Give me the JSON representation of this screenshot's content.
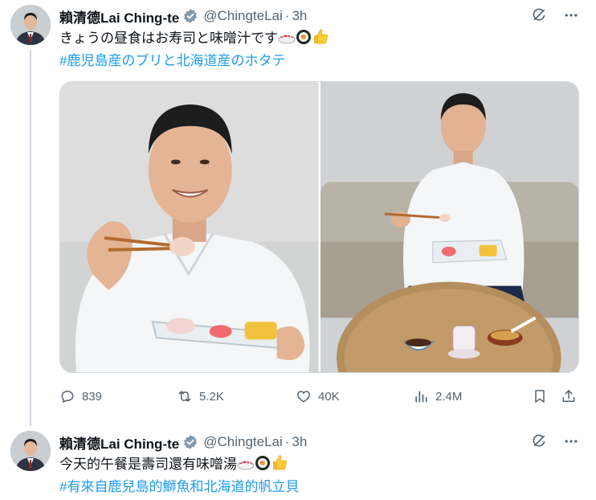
{
  "tweets": [
    {
      "author_name": "賴清德Lai Ching-te",
      "handle": "@ChingteLai",
      "separator": "·",
      "time": "3h",
      "text": "きょうの昼食はお寿司と味噌汁です",
      "hashtag": "#鹿児島産のブリと北海道産のホタテ",
      "metrics": {
        "replies": "839",
        "retweets": "5.2K",
        "likes": "40K",
        "views": "2.4M"
      }
    },
    {
      "author_name": "賴清德Lai Ching-te",
      "handle": "@ChingteLai",
      "separator": "·",
      "time": "3h",
      "text": "今天的午餐是壽司還有味噌湯",
      "hashtag": "#有來自鹿兒島的鰤魚和北海道的帆立貝"
    }
  ],
  "icons": [
    "verified-badge-icon",
    "grok-icon",
    "more-icon",
    "reply-icon",
    "retweet-icon",
    "like-icon",
    "views-icon",
    "bookmark-icon",
    "share-icon",
    "sushi-emoji",
    "thumbs-up-emoji"
  ],
  "colors": {
    "accent": "#1d9bf0",
    "secondary_text": "#536471",
    "primary_text": "#0f1419",
    "border": "#cfd9de"
  }
}
